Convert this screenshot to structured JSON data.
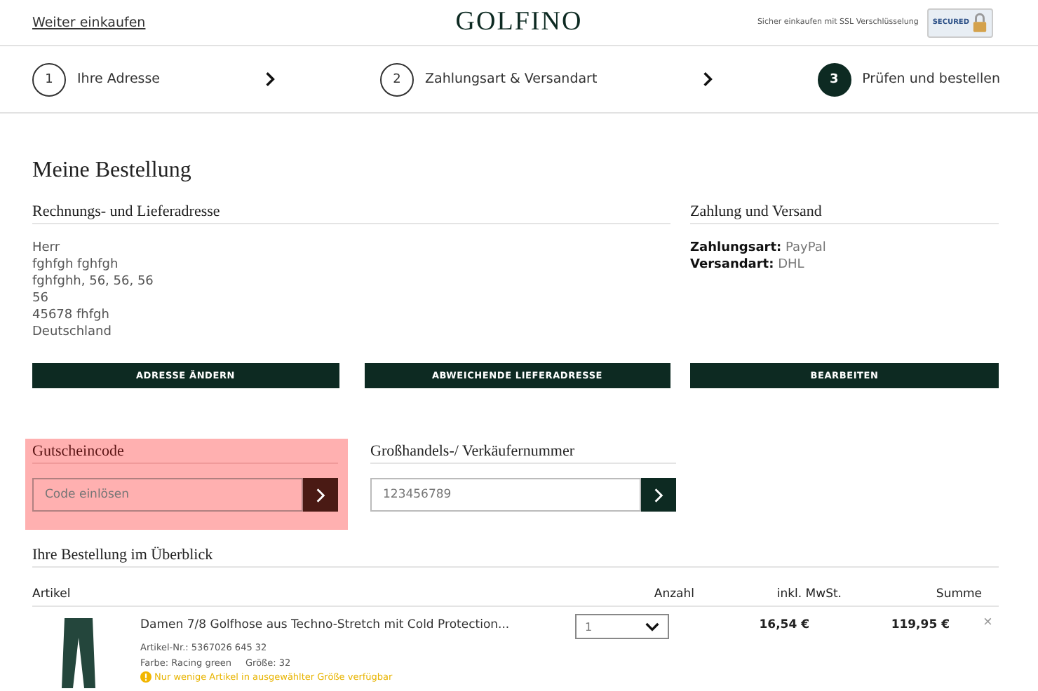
{
  "header": {
    "back_link": "Weiter einkaufen",
    "logo": "GOLFINO",
    "ssl_note": "Sicher einkaufen mit SSL Verschlüsselung",
    "seal": "SECURED"
  },
  "steps": [
    {
      "number": "1",
      "label": "Ihre Adresse",
      "selected": false
    },
    {
      "number": "2",
      "label": "Zahlungsart & Versandart",
      "selected": false
    },
    {
      "number": "3",
      "label": "Prüfen und bestellen",
      "selected": true
    }
  ],
  "title": "Meine Bestellung",
  "address": {
    "heading": "Rechnungs- und Lieferadresse",
    "lines": [
      "Herr",
      "fghfgh fghfgh",
      "fghfghh, 56, 56, 56",
      "56",
      "45678 fhfgh",
      "Deutschland"
    ],
    "buttons": [
      "ADRESSE ÄNDERN",
      "ABWEICHENDE LIEFERADRESSE"
    ]
  },
  "payment": {
    "heading": "Zahlung und Versand",
    "rows": [
      {
        "label": "Zahlungsart:",
        "value": "PayPal"
      },
      {
        "label": "Versandart:",
        "value": "DHL"
      }
    ],
    "button": "BEARBEITEN"
  },
  "codes": [
    {
      "heading": "Gutscheincode",
      "placeholder": "Code einlösen",
      "highlighted": true
    },
    {
      "heading": "Großhandels-/ Verkäufernummer",
      "placeholder": "123456789",
      "highlighted": false
    }
  ],
  "overview": {
    "heading": "Ihre Bestellung im Überblick",
    "columns": [
      "Artikel",
      "Anzahl",
      "inkl. MwSt.",
      "Summe"
    ],
    "rows": [
      {
        "name": "Damen 7/8 Golfhose aus Techno-Stretch mit Cold Protection...",
        "article_no": "Artikel-Nr.: 5367026 645 32",
        "color_text": "Farbe: Racing green",
        "size": "Größe: 32",
        "warning": "Nur wenige Artikel in ausgewählter Größe verfügbar",
        "quantity": "1",
        "tax": "16,54  €",
        "total": "119,95  €",
        "remove": "×"
      }
    ]
  }
}
